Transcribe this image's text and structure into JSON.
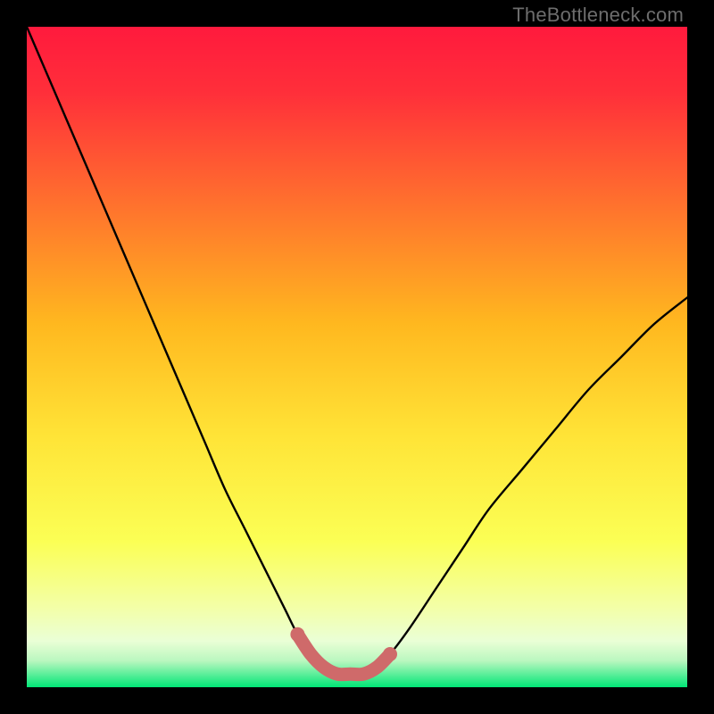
{
  "watermark": "TheBottleneck.com",
  "colors": {
    "frame": "#000000",
    "curve": "#000000",
    "accent": "#cf6a6a",
    "gradient_top": "#ff1a3d",
    "gradient_mid_upper": "#ff7a2a",
    "gradient_mid": "#ffd400",
    "gradient_mid_lower": "#f6ff6b",
    "gradient_pale": "#f4ffd0",
    "gradient_bottom": "#00e676"
  },
  "chart_data": {
    "type": "line",
    "title": "",
    "xlabel": "",
    "ylabel": "",
    "xlim": [
      0,
      100
    ],
    "ylim": [
      0,
      100
    ],
    "series": [
      {
        "name": "bottleneck-curve",
        "x": [
          0,
          3,
          6,
          9,
          12,
          15,
          18,
          21,
          24,
          27,
          30,
          33,
          36,
          39,
          41,
          43,
          45,
          47,
          49,
          51,
          53,
          55,
          58,
          62,
          66,
          70,
          75,
          80,
          85,
          90,
          95,
          100
        ],
        "y": [
          100,
          93,
          86,
          79,
          72,
          65,
          58,
          51,
          44,
          37,
          30,
          24,
          18,
          12,
          8,
          5,
          3,
          2,
          2,
          2,
          3,
          5,
          9,
          15,
          21,
          27,
          33,
          39,
          45,
          50,
          55,
          59
        ]
      }
    ],
    "accent_region": {
      "x_start": 41,
      "x_end": 55,
      "y_at_bottom": 2
    },
    "annotations": []
  }
}
